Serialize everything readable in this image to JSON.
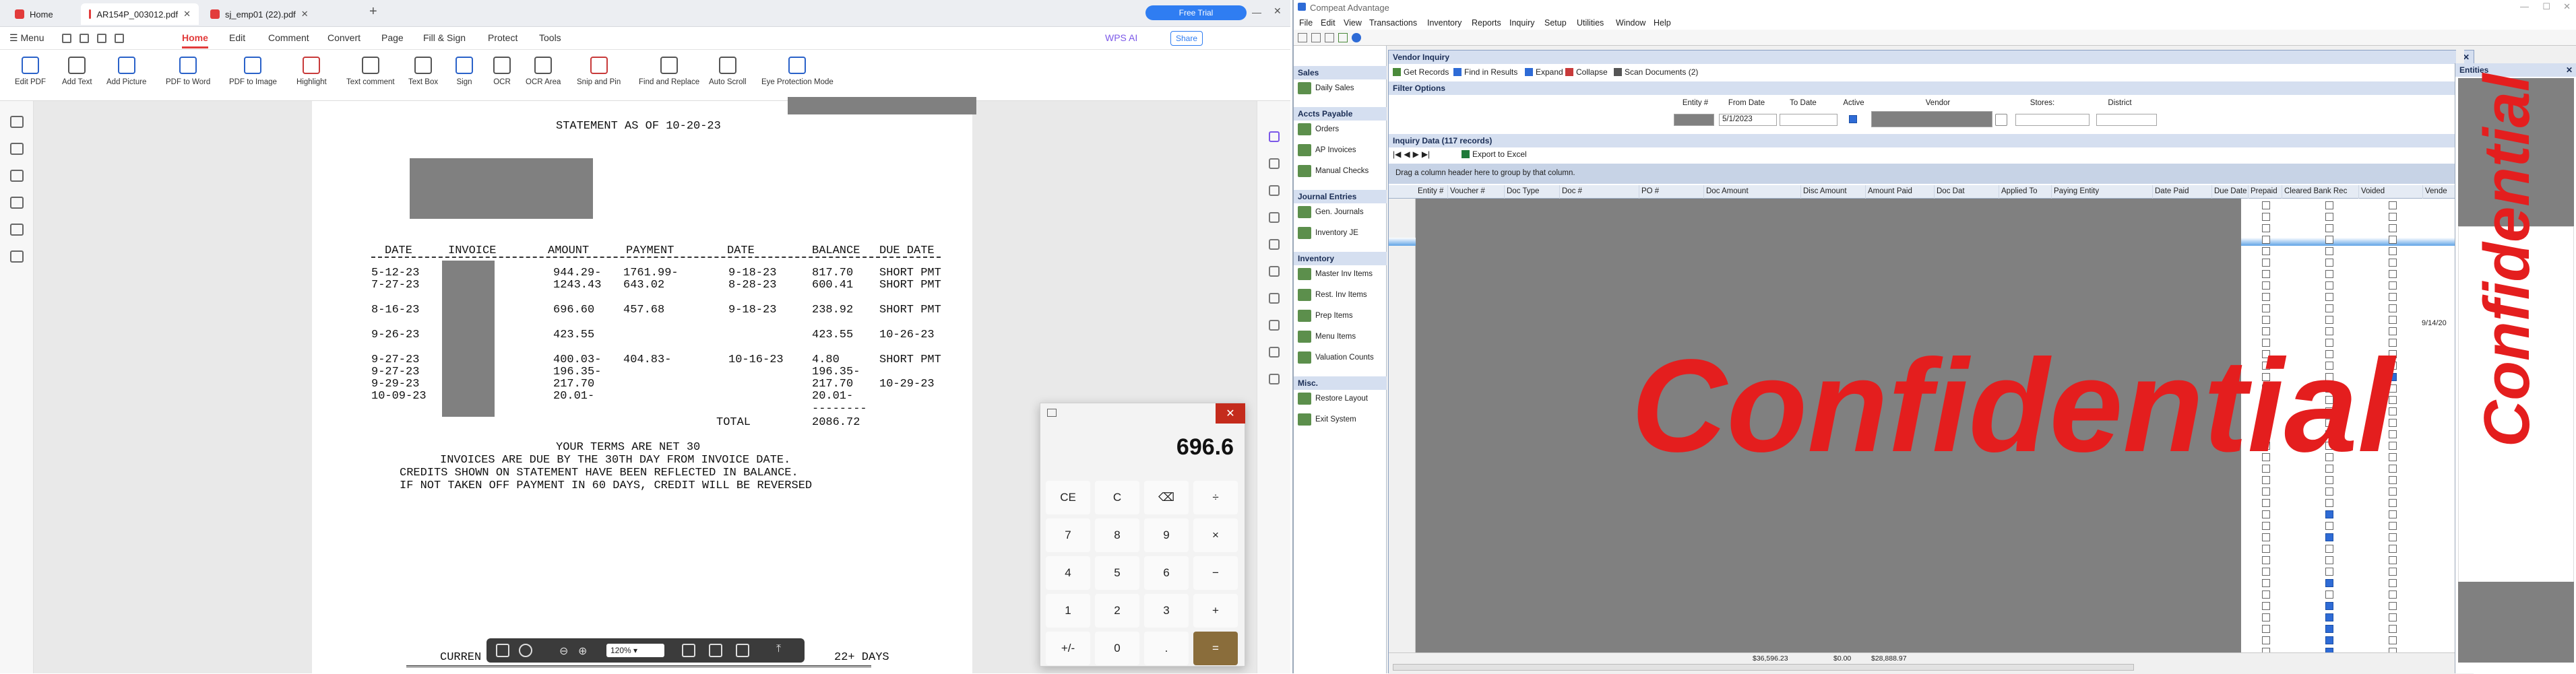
{
  "pdf_app": {
    "tabs": [
      {
        "label": "Home"
      },
      {
        "label": "AR154P_003012.pdf"
      },
      {
        "label": "sj_emp01 (22).pdf"
      }
    ],
    "free_trial": "Free Trial",
    "wps_ai": "WPS AI",
    "share": "Share",
    "menu": {
      "hamburger": "Menu",
      "items": [
        "Home",
        "Edit",
        "Comment",
        "Convert",
        "Page",
        "Fill & Sign",
        "Protect",
        "Tools"
      ]
    },
    "toolbar": [
      "Edit PDF",
      "Add Text",
      "Add Picture",
      "PDF to Word",
      "PDF to Image",
      "Highlight",
      "Text comment",
      "Text Box",
      "Sign",
      "OCR",
      "OCR Area",
      "Snip and Pin",
      "Find and Replace",
      "Auto Scroll",
      "Eye Protection Mode"
    ],
    "zoom": "120%",
    "document": {
      "heading": "STATEMENT AS OF 10-20-23",
      "columns": [
        "DATE",
        "INVOICE",
        "AMOUNT",
        "PAYMENT",
        "DATE",
        "BALANCE",
        "DUE DATE"
      ],
      "rows": [
        {
          "date": "5-12-23",
          "amount": "944.29-",
          "payment": "1761.99-",
          "pdate": "9-18-23",
          "balance": "817.70",
          "due": "SHORT PMT"
        },
        {
          "date": "7-27-23",
          "amount": "1243.43",
          "payment": "643.02",
          "pdate": "8-28-23",
          "balance": "600.41",
          "due": "SHORT PMT"
        },
        {
          "date": "8-16-23",
          "amount": "696.60",
          "payment": "457.68",
          "pdate": "9-18-23",
          "balance": "238.92",
          "due": "SHORT PMT"
        },
        {
          "date": "9-26-23",
          "amount": "423.55",
          "payment": "",
          "pdate": "",
          "balance": "423.55",
          "due": "10-26-23"
        },
        {
          "date": "9-27-23",
          "amount": "400.03-",
          "payment": "404.83-",
          "pdate": "10-16-23",
          "balance": "4.80",
          "due": "SHORT PMT"
        },
        {
          "date": "9-27-23",
          "amount": "196.35-",
          "payment": "",
          "pdate": "",
          "balance": "196.35-",
          "due": ""
        },
        {
          "date": "9-29-23",
          "amount": "217.70",
          "payment": "",
          "pdate": "",
          "balance": "217.70",
          "due": "10-29-23"
        },
        {
          "date": "10-09-23",
          "amount": "20.01-",
          "payment": "",
          "pdate": "",
          "balance": "20.01-",
          "due": ""
        }
      ],
      "total_label": "TOTAL",
      "total_value": "2086.72",
      "terms": [
        "YOUR TERMS ARE NET 30",
        "INVOICES ARE DUE BY THE 30TH DAY FROM INVOICE DATE.",
        "CREDITS SHOWN ON STATEMENT HAVE BEEN REFLECTED IN BALANCE.",
        "IF NOT TAKEN OFF PAYMENT IN 60 DAYS, CREDIT WILL BE REVERSED"
      ],
      "footer_left": "CURREN",
      "footer_right": "22+ DAYS"
    },
    "calculator": {
      "display": "696.6",
      "keys": [
        "CE",
        "C",
        "⌫",
        "÷",
        "7",
        "8",
        "9",
        "×",
        "4",
        "5",
        "6",
        "−",
        "1",
        "2",
        "3",
        "+",
        "+/-",
        "0",
        ".",
        "="
      ]
    }
  },
  "compeat": {
    "title": "Compeat Advantage",
    "menu": [
      "File",
      "Edit",
      "View",
      "Transactions",
      "Inventory",
      "Reports",
      "Inquiry",
      "Setup",
      "Utilities",
      "Window",
      "Help"
    ],
    "sidebar": [
      {
        "header": "Sales",
        "items": [
          "Daily Sales"
        ]
      },
      {
        "header": "Accts Payable",
        "items": [
          "Orders",
          "AP Invoices",
          "Manual Checks"
        ]
      },
      {
        "header": "Journal Entries",
        "items": [
          "Gen. Journals",
          "Inventory JE"
        ]
      },
      {
        "header": "Inventory",
        "items": [
          "Master Inv Items",
          "Rest. Inv Items",
          "Prep Items",
          "Menu Items",
          "Valuation Counts"
        ]
      },
      {
        "header": "Misc.",
        "items": [
          "Restore Layout",
          "Exit System"
        ]
      }
    ],
    "vendor_inquiry": {
      "title": "Vendor Inquiry",
      "buttons": [
        "Get Records",
        "Find in Results",
        "Expand",
        "Collapse",
        "Scan Documents (2)"
      ],
      "filter_header": "Filter Options",
      "filters": {
        "entity_label": "Entity #",
        "from_label": "From Date",
        "from_value": "5/1/2023",
        "to_label": "To Date",
        "active_label": "Active",
        "vendor_label": "Vendor",
        "stores_label": "Stores:",
        "district_label": "District"
      },
      "inquiry_header": "Inquiry Data (117 records)",
      "export": "Export to Excel",
      "group_hint": "Drag a column header here to group by that column.",
      "columns": [
        "Entity #",
        "Voucher #",
        "Doc Type",
        "Doc #",
        "PO #",
        "Doc Amount",
        "Disc Amount",
        "Amount Paid",
        "Doc Dat",
        "Applied To",
        "Paying Entity",
        "Date Paid",
        "Due Date",
        "Prepaid",
        "Cleared Bank Rec",
        "Voided",
        "Vende"
      ],
      "date_cell": "9/14/20",
      "totals": [
        "$36,596.23",
        "$0.00",
        "$28,888.97"
      ]
    },
    "watermark": "Confidential",
    "entities_panel": "Entities"
  }
}
